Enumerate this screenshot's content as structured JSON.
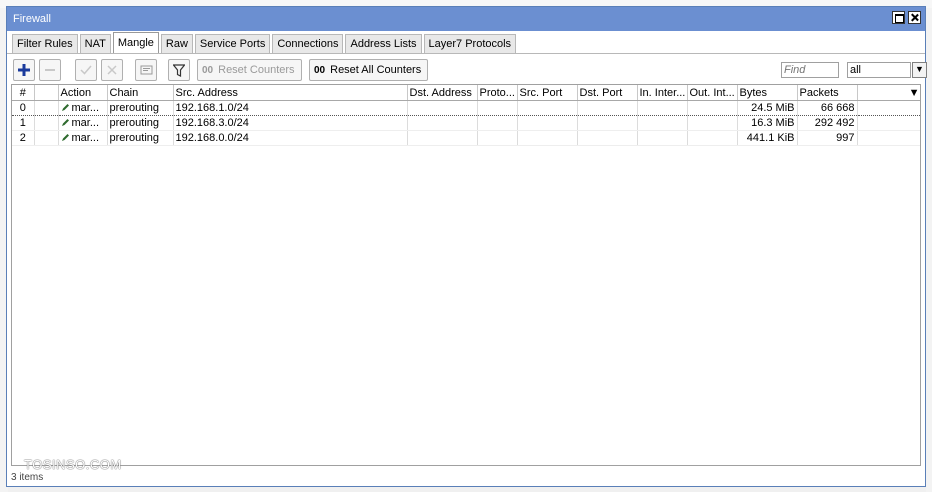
{
  "window": {
    "title": "Firewall"
  },
  "tabs": [
    {
      "label": "Filter Rules",
      "active": false
    },
    {
      "label": "NAT",
      "active": false
    },
    {
      "label": "Mangle",
      "active": true
    },
    {
      "label": "Raw",
      "active": false
    },
    {
      "label": "Service Ports",
      "active": false
    },
    {
      "label": "Connections",
      "active": false
    },
    {
      "label": "Address Lists",
      "active": false
    },
    {
      "label": "Layer7 Protocols",
      "active": false
    }
  ],
  "toolbar": {
    "reset_counters": "Reset Counters",
    "reset_all_counters": "Reset All Counters",
    "counter_icon": "00",
    "find_placeholder": "Find",
    "filter_value": "all",
    "icons": [
      "add-icon",
      "remove-icon",
      "enable-icon",
      "disable-icon",
      "comment-icon",
      "filter-icon"
    ]
  },
  "table": {
    "columns": [
      "#",
      "",
      "Action",
      "Chain",
      "Src. Address",
      "Dst. Address",
      "Proto...",
      "Src. Port",
      "Dst. Port",
      "In. Inter...",
      "Out. Int...",
      "Bytes",
      "Packets",
      ""
    ],
    "rows": [
      {
        "num": "0",
        "action": "mar...",
        "chain": "prerouting",
        "src": "192.168.1.0/24",
        "dst": "",
        "proto": "",
        "sport": "",
        "dport": "",
        "in": "",
        "out": "",
        "bytes": "24.5 MiB",
        "packets": "66 668"
      },
      {
        "num": "1",
        "action": "mar...",
        "chain": "prerouting",
        "src": "192.168.3.0/24",
        "dst": "",
        "proto": "",
        "sport": "",
        "dport": "",
        "in": "",
        "out": "",
        "bytes": "16.3 MiB",
        "packets": "292 492"
      },
      {
        "num": "2",
        "action": "mar...",
        "chain": "prerouting",
        "src": "192.168.0.0/24",
        "dst": "",
        "proto": "",
        "sport": "",
        "dport": "",
        "in": "",
        "out": "",
        "bytes": "441.1 KiB",
        "packets": "997"
      }
    ]
  },
  "status": {
    "items_count": "3 items"
  },
  "watermark": "TOSINSO.COM",
  "colors": {
    "titlebar": "#6b8fd1",
    "add_icon": "#1a3a9c"
  }
}
